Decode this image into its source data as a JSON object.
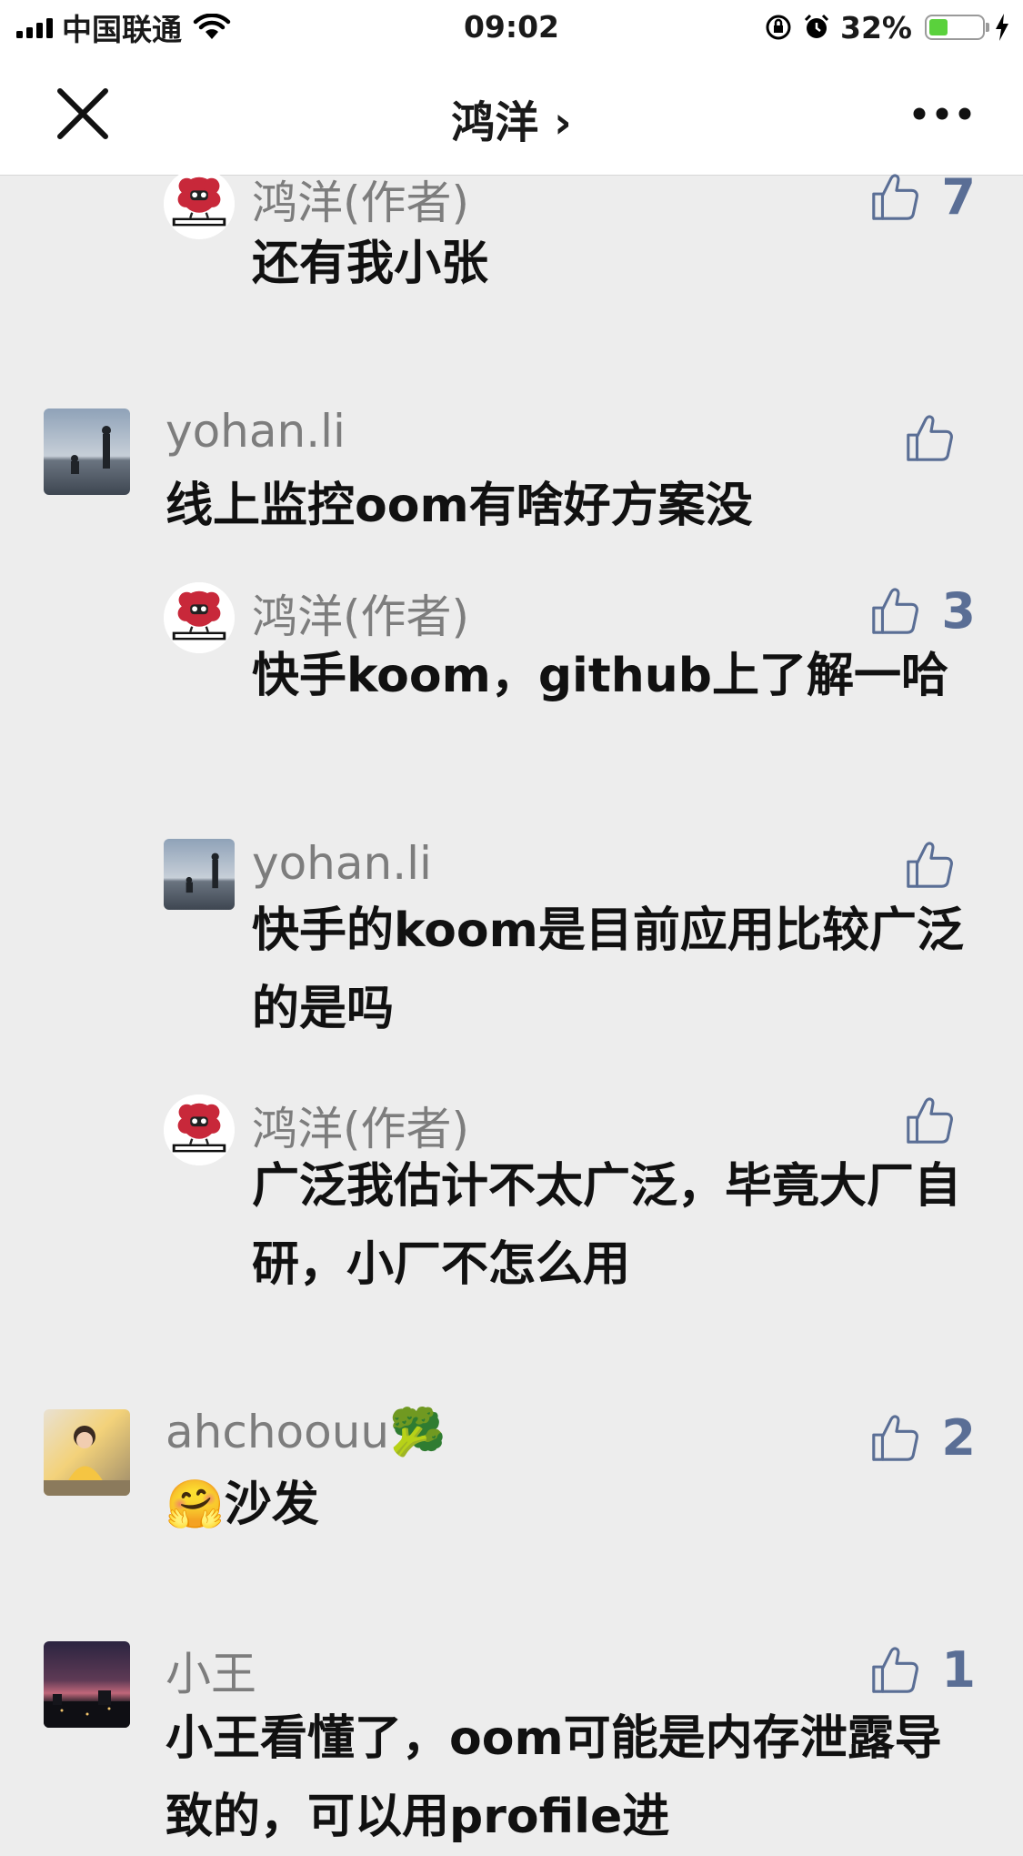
{
  "status_bar": {
    "carrier": "中国联通",
    "time": "09:02",
    "battery_percent": "32%",
    "battery_level": 0.32
  },
  "nav": {
    "title": "鸿洋 ›",
    "close_icon": "close-icon",
    "more_icon": "more-icon"
  },
  "comments": [
    {
      "id": "c1",
      "nick": "鸿洋(作者)",
      "text": "还有我小张",
      "likes": "7",
      "avatar": "hongyang-logo",
      "reply": true
    },
    {
      "id": "c2",
      "nick": "yohan.li",
      "text": "线上监控oom有啥好方案没",
      "likes": "",
      "avatar": "seaside-photo",
      "reply": false
    },
    {
      "id": "c3",
      "nick": "鸿洋(作者)",
      "text": "快手koom，github上了解一哈",
      "likes": "3",
      "avatar": "hongyang-logo",
      "reply": true
    },
    {
      "id": "c4",
      "nick": "yohan.li",
      "text": "快手的koom是目前应用比较广泛的是吗",
      "likes": "",
      "avatar": "seaside-photo",
      "reply": true
    },
    {
      "id": "c5",
      "nick": "鸿洋(作者)",
      "text": "广泛我估计不太广泛，毕竟大厂自研，小厂不怎么用",
      "likes": "",
      "avatar": "hongyang-logo",
      "reply": true
    },
    {
      "id": "c6",
      "nick": "ahchoouu🥦",
      "text": "🤗沙发",
      "likes": "2",
      "avatar": "girl-photo",
      "reply": false
    },
    {
      "id": "c7",
      "nick": "小王",
      "text": "小王看懂了，oom可能是内存泄露导致的，可以用profile进",
      "likes": "1",
      "avatar": "night-city-photo",
      "reply": false
    }
  ],
  "colors": {
    "background": "#ededed",
    "nick": "#7d7d7d",
    "like": "#5a6e95",
    "hongyang_red": "#c8283a"
  }
}
